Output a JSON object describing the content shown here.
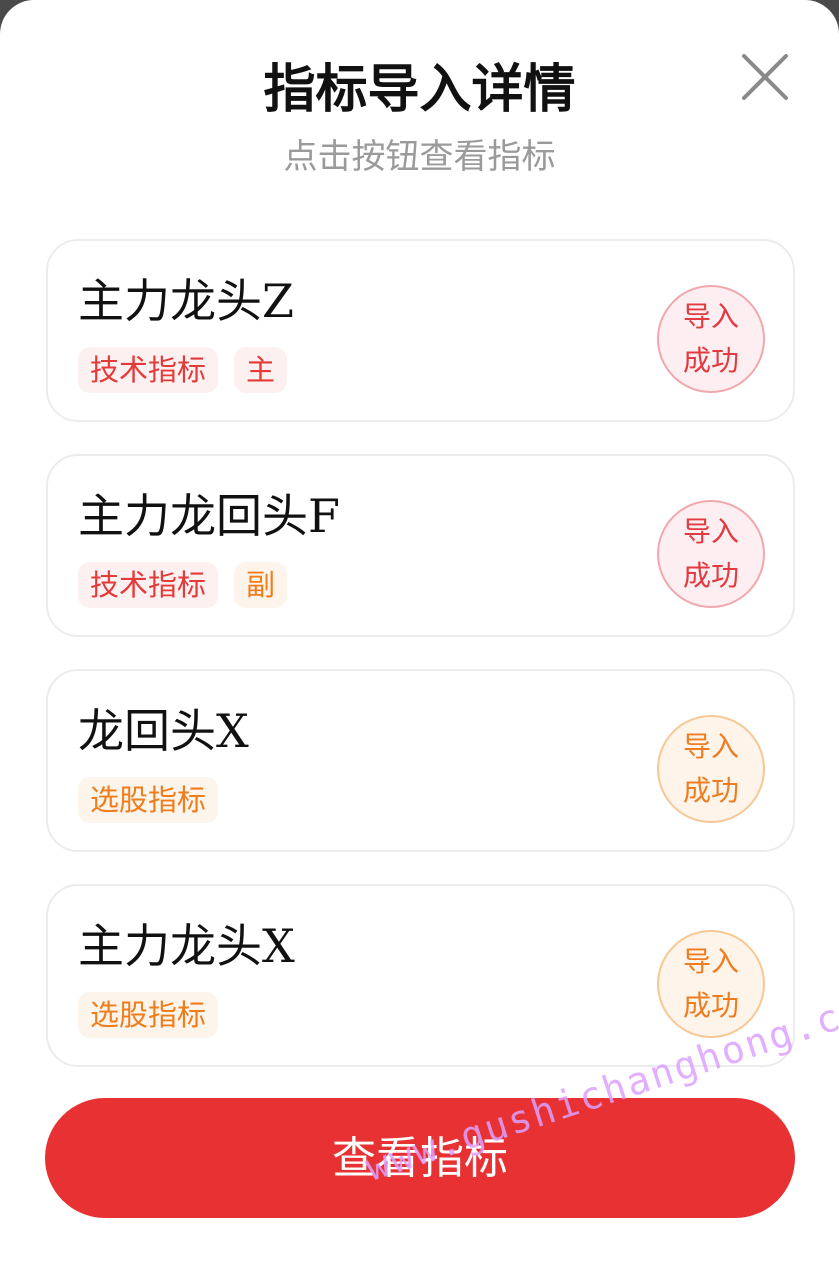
{
  "modal": {
    "title": "指标导入详情",
    "subtitle": "点击按钮查看指标"
  },
  "icons": {
    "close": "close-icon"
  },
  "colors": {
    "red": "#e33a3a",
    "orange": "#ef7d1c",
    "button": "#e83132"
  },
  "indicators": [
    {
      "name": "主力龙头Z",
      "tags": [
        {
          "label": "技术指标"
        },
        {
          "label": "主"
        }
      ],
      "status": "导入\n成功"
    },
    {
      "name": "主力龙回头F",
      "tags": [
        {
          "label": "技术指标"
        },
        {
          "label": "副"
        }
      ],
      "status": "导入\n成功"
    },
    {
      "name": "龙回头X",
      "tags": [
        {
          "label": "选股指标"
        }
      ],
      "status": "导入\n成功"
    },
    {
      "name": "主力龙头X",
      "tags": [
        {
          "label": "选股指标"
        }
      ],
      "status": "导入\n成功"
    }
  ],
  "footer": {
    "view_button": "查看指标"
  },
  "watermark": "www.gushichanghong.com"
}
